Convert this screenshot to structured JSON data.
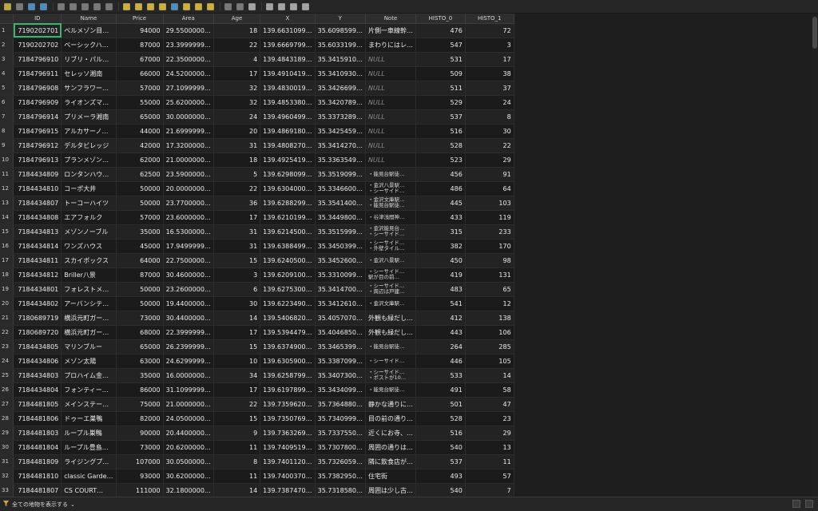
{
  "toolbar": {
    "icons": [
      "pencil-icon",
      "multi-edit-icon",
      "save-icon",
      "reload-icon",
      "add-feature-icon",
      "delete-feature-icon",
      "cut-icon",
      "copy-icon",
      "paste-icon",
      "select-by-expression-icon",
      "select-all-icon",
      "invert-selection-icon",
      "deselect-icon",
      "filter-icon",
      "move-selection-to-top-icon",
      "pan-to-selected-icon",
      "zoom-to-selected-icon",
      "new-field-icon",
      "delete-field-icon",
      "field-calculator-icon",
      "conditional-formatting-icon",
      "dock-icon",
      "actions-icon",
      "zoom-icon"
    ]
  },
  "table": {
    "columns": [
      "ID",
      "Name",
      "Price",
      "Area",
      "Age",
      "X",
      "Y",
      "Note",
      "HISTO_0",
      "HISTO_1"
    ],
    "rows": [
      {
        "n": "1",
        "id": "7190202701",
        "name": "ベルメゾン目…",
        "price": "94000",
        "area": "29.5500000…",
        "age": "18",
        "x": "139.6631099…",
        "y": "35.6098599…",
        "note": "片側一車線幹…",
        "note_type": "text",
        "h0": "476",
        "h1": "72"
      },
      {
        "n": "2",
        "id": "7190202702",
        "name": "ベーシックハ…",
        "price": "87000",
        "area": "23.3999999…",
        "age": "22",
        "x": "139.6669799…",
        "y": "35.6033199…",
        "note": "まわりにはレ…",
        "note_type": "text",
        "h0": "547",
        "h1": "3"
      },
      {
        "n": "3",
        "id": "7184796910",
        "name": "リブリ・パル…",
        "price": "67000",
        "area": "22.3500000…",
        "age": "4",
        "x": "139.4843189…",
        "y": "35.3415910…",
        "note": "NULL",
        "note_type": "null",
        "h0": "531",
        "h1": "17"
      },
      {
        "n": "4",
        "id": "7184796911",
        "name": "セレッソ湘南",
        "price": "66000",
        "area": "24.5200000…",
        "age": "17",
        "x": "139.4910419…",
        "y": "35.3410930…",
        "note": "NULL",
        "note_type": "null",
        "h0": "509",
        "h1": "38"
      },
      {
        "n": "5",
        "id": "7184796908",
        "name": "サンフラワー…",
        "price": "57000",
        "area": "27.1099999…",
        "age": "32",
        "x": "139.4830019…",
        "y": "35.3426699…",
        "note": "NULL",
        "note_type": "null",
        "h0": "511",
        "h1": "37"
      },
      {
        "n": "6",
        "id": "7184796909",
        "name": "ライオンズマ…",
        "price": "55000",
        "area": "25.6200000…",
        "age": "32",
        "x": "139.4853380…",
        "y": "35.3420789…",
        "note": "NULL",
        "note_type": "null",
        "h0": "529",
        "h1": "24"
      },
      {
        "n": "7",
        "id": "7184796914",
        "name": "プリメーラ湘南",
        "price": "65000",
        "area": "30.0000000…",
        "age": "24",
        "x": "139.4960499…",
        "y": "35.3373289…",
        "note": "NULL",
        "note_type": "null",
        "h0": "537",
        "h1": "8"
      },
      {
        "n": "8",
        "id": "7184796915",
        "name": "アルカサーノ…",
        "price": "44000",
        "area": "21.6999999…",
        "age": "20",
        "x": "139.4869180…",
        "y": "35.3425459…",
        "note": "NULL",
        "note_type": "null",
        "h0": "516",
        "h1": "30"
      },
      {
        "n": "9",
        "id": "7184796912",
        "name": "デルタビレッジ",
        "price": "42000",
        "area": "17.3200000…",
        "age": "31",
        "x": "139.4808270…",
        "y": "35.3414270…",
        "note": "NULL",
        "note_type": "null",
        "h0": "528",
        "h1": "22"
      },
      {
        "n": "10",
        "id": "7184796913",
        "name": "プランメゾン…",
        "price": "62000",
        "area": "21.0000000…",
        "age": "18",
        "x": "139.4925419…",
        "y": "35.3363549…",
        "note": "NULL",
        "note_type": "null",
        "h0": "523",
        "h1": "29"
      },
      {
        "n": "11",
        "id": "7184434809",
        "name": "ロンタンハウ…",
        "price": "62500",
        "area": "23.5900000…",
        "age": "5",
        "x": "139.6298099…",
        "y": "35.3519099…",
        "note": "・能見台駅徒…",
        "note_type": "stack",
        "h0": "456",
        "h1": "91"
      },
      {
        "n": "12",
        "id": "7184434810",
        "name": "コーポ大井",
        "price": "50000",
        "area": "20.0000000…",
        "age": "22",
        "x": "139.6304000…",
        "y": "35.3346600…",
        "note": "・金沢八景駅…\n・シーサイド…",
        "note_type": "stack",
        "h0": "486",
        "h1": "64"
      },
      {
        "n": "13",
        "id": "7184434807",
        "name": "トーコーハイツ",
        "price": "50000",
        "area": "23.7700000…",
        "age": "36",
        "x": "139.6288299…",
        "y": "35.3541400…",
        "note": "・金沢文庫駅…\n・能見台駅徒…",
        "note_type": "stack",
        "h0": "445",
        "h1": "103"
      },
      {
        "n": "14",
        "id": "7184434808",
        "name": "エアフォルク",
        "price": "57000",
        "area": "23.6000000…",
        "age": "17",
        "x": "139.6210199…",
        "y": "35.3449800…",
        "note": "・谷津浅間神…",
        "note_type": "stack",
        "h0": "433",
        "h1": "119"
      },
      {
        "n": "15",
        "id": "7184434813",
        "name": "メゾンノーブル",
        "price": "35000",
        "area": "16.5300000…",
        "age": "31",
        "x": "139.6214500…",
        "y": "35.3515999…",
        "note": "・金沢能見台…\n・シーサイド…",
        "note_type": "stack",
        "h0": "315",
        "h1": "233"
      },
      {
        "n": "16",
        "id": "7184434814",
        "name": "ワンズハウス",
        "price": "45000",
        "area": "17.9499999…",
        "age": "31",
        "x": "139.6388499…",
        "y": "35.3450399…",
        "note": "・シーサイド…\n・外壁タイル…",
        "note_type": "stack",
        "h0": "382",
        "h1": "170"
      },
      {
        "n": "17",
        "id": "7184434811",
        "name": "スカイボックス",
        "price": "64000",
        "area": "22.7500000…",
        "age": "15",
        "x": "139.6240500…",
        "y": "35.3452600…",
        "note": "・金沢八景駅…",
        "note_type": "stack",
        "h0": "450",
        "h1": "98"
      },
      {
        "n": "18",
        "id": "7184434812",
        "name": "Briller八景",
        "price": "87000",
        "area": "30.4600000…",
        "age": "3",
        "x": "139.6209100…",
        "y": "35.3310099…",
        "note": "・シーサイド…\n駅が目の前…",
        "note_type": "stack",
        "h0": "419",
        "h1": "131"
      },
      {
        "n": "19",
        "id": "7184434801",
        "name": "フォレストメ…",
        "price": "50000",
        "area": "23.2600000…",
        "age": "6",
        "x": "139.6275300…",
        "y": "35.3414700…",
        "note": "・シーサイド…\n・周辺は戸建…",
        "note_type": "stack",
        "h0": "483",
        "h1": "65"
      },
      {
        "n": "20",
        "id": "7184434802",
        "name": "アーバンシテ…",
        "price": "50000",
        "area": "19.4400000…",
        "age": "30",
        "x": "139.6223490…",
        "y": "35.3412610…",
        "note": "・金沢文庫駅…",
        "note_type": "stack",
        "h0": "541",
        "h1": "12"
      },
      {
        "n": "21",
        "id": "7180689719",
        "name": "横浜元町ガー…",
        "price": "73000",
        "area": "30.4400000…",
        "age": "14",
        "x": "139.5406820…",
        "y": "35.4057070…",
        "note": "外観も緑だし…",
        "note_type": "text",
        "h0": "412",
        "h1": "138"
      },
      {
        "n": "22",
        "id": "7180689720",
        "name": "横浜元町ガー…",
        "price": "68000",
        "area": "22.3999999…",
        "age": "17",
        "x": "139.5394479…",
        "y": "35.4046850…",
        "note": "外観も緑だし…",
        "note_type": "text",
        "h0": "443",
        "h1": "106"
      },
      {
        "n": "23",
        "id": "7184434805",
        "name": "マリンブルー",
        "price": "65000",
        "area": "26.2399999…",
        "age": "15",
        "x": "139.6374900…",
        "y": "35.3465399…",
        "note": "・能見台駅徒…",
        "note_type": "stack",
        "h0": "264",
        "h1": "285"
      },
      {
        "n": "24",
        "id": "7184434806",
        "name": "メゾン太陽",
        "price": "63000",
        "area": "24.6299999…",
        "age": "10",
        "x": "139.6305900…",
        "y": "35.3387099…",
        "note": "・シーサイド…",
        "note_type": "stack",
        "h0": "446",
        "h1": "105"
      },
      {
        "n": "25",
        "id": "7184434803",
        "name": "プロハイム金…",
        "price": "35000",
        "area": "16.0000000…",
        "age": "34",
        "x": "139.6258799…",
        "y": "35.3407300…",
        "note": "・シーサイド…\n・ポストが10…",
        "note_type": "stack",
        "h0": "533",
        "h1": "14"
      },
      {
        "n": "26",
        "id": "7184434804",
        "name": "フォンティー…",
        "price": "86000",
        "area": "31.1099999…",
        "age": "17",
        "x": "139.6197899…",
        "y": "35.3434099…",
        "note": "・能見台駅徒…",
        "note_type": "stack",
        "h0": "491",
        "h1": "58"
      },
      {
        "n": "27",
        "id": "7184481805",
        "name": "メインステー…",
        "price": "75000",
        "area": "21.0000000…",
        "age": "22",
        "x": "139.7359620…",
        "y": "35.7364880…",
        "note": "静かな通りに…",
        "note_type": "text",
        "h0": "501",
        "h1": "47"
      },
      {
        "n": "28",
        "id": "7184481806",
        "name": "ドゥーエ巣鴨",
        "price": "82000",
        "area": "24.0500000…",
        "age": "15",
        "x": "139.7350769…",
        "y": "35.7340999…",
        "note": "目の前の通り…",
        "note_type": "text",
        "h0": "528",
        "h1": "23"
      },
      {
        "n": "29",
        "id": "7184481803",
        "name": "ループル巣鴨",
        "price": "90000",
        "area": "20.4400000…",
        "age": "9",
        "x": "139.7363269…",
        "y": "35.7337550…",
        "note": "近くにお寺、…",
        "note_type": "text",
        "h0": "516",
        "h1": "29"
      },
      {
        "n": "30",
        "id": "7184481804",
        "name": "ループル豊島…",
        "price": "73000",
        "area": "20.6200000…",
        "age": "11",
        "x": "139.7409519…",
        "y": "35.7307800…",
        "note": "周囲の通りは…",
        "note_type": "text",
        "h0": "540",
        "h1": "13"
      },
      {
        "n": "31",
        "id": "7184481809",
        "name": "ライジングプ…",
        "price": "107000",
        "area": "30.0500000…",
        "age": "8",
        "x": "139.7401120…",
        "y": "35.7326059…",
        "note": "隣に飲食店が…",
        "note_type": "text",
        "h0": "537",
        "h1": "11"
      },
      {
        "n": "32",
        "id": "7184481810",
        "name": "classic Garde…",
        "price": "93000",
        "area": "30.6200000…",
        "age": "11",
        "x": "139.7400370…",
        "y": "35.7382950…",
        "note": "住宅街",
        "note_type": "text",
        "h0": "493",
        "h1": "57"
      },
      {
        "n": "33",
        "id": "7184481807",
        "name": "CS COURT…",
        "price": "111000",
        "area": "32.1800000…",
        "age": "14",
        "x": "139.7387470…",
        "y": "35.7318580…",
        "note": "周囲は少し古…",
        "note_type": "text",
        "h0": "540",
        "h1": "7"
      }
    ]
  },
  "statusbar": {
    "filter_label": "全ての地物を表示する",
    "icons": [
      "table-view-icon",
      "form-view-icon"
    ]
  },
  "colors": {
    "selection": "#3cb371",
    "background": "#1e1e1e"
  }
}
